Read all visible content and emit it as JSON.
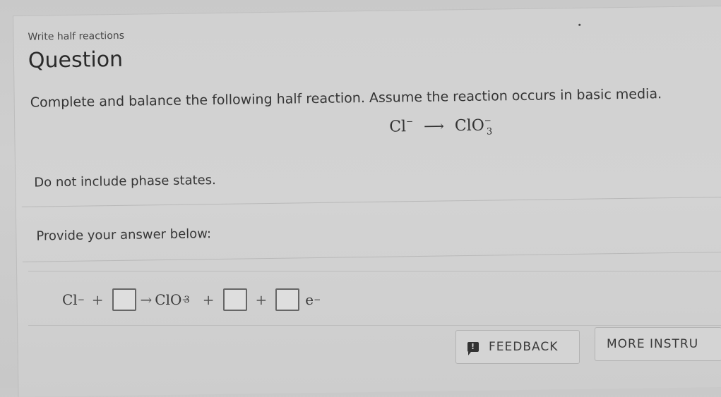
{
  "header": {
    "breadcrumb": "Write half reactions",
    "title": "Question"
  },
  "question": {
    "prompt": "Complete and balance the following half reaction. Assume the reaction occurs in basic media.",
    "reaction": {
      "reactant": {
        "symbol": "Cl",
        "charge": "−"
      },
      "arrow": "⟶",
      "product": {
        "symbol": "ClO",
        "subscript": "3",
        "charge": "−"
      }
    },
    "note": "Do not include phase states."
  },
  "answer": {
    "label": "Provide your answer below:",
    "equation": {
      "reactant": {
        "symbol": "Cl",
        "charge": "−"
      },
      "plus1": "+",
      "blank1_value": "",
      "arrow": "→",
      "product": {
        "symbol": "ClO",
        "subscript": "3",
        "charge": "−"
      },
      "plus2": "+",
      "blank2_value": "",
      "plus3": "+",
      "blank3_value": "",
      "electron": {
        "symbol": "e",
        "charge": "−"
      }
    }
  },
  "buttons": {
    "feedback_label": "FEEDBACK",
    "feedback_icon": "feedback-exclamation-icon",
    "more_instructions_label": "MORE INSTRU"
  }
}
